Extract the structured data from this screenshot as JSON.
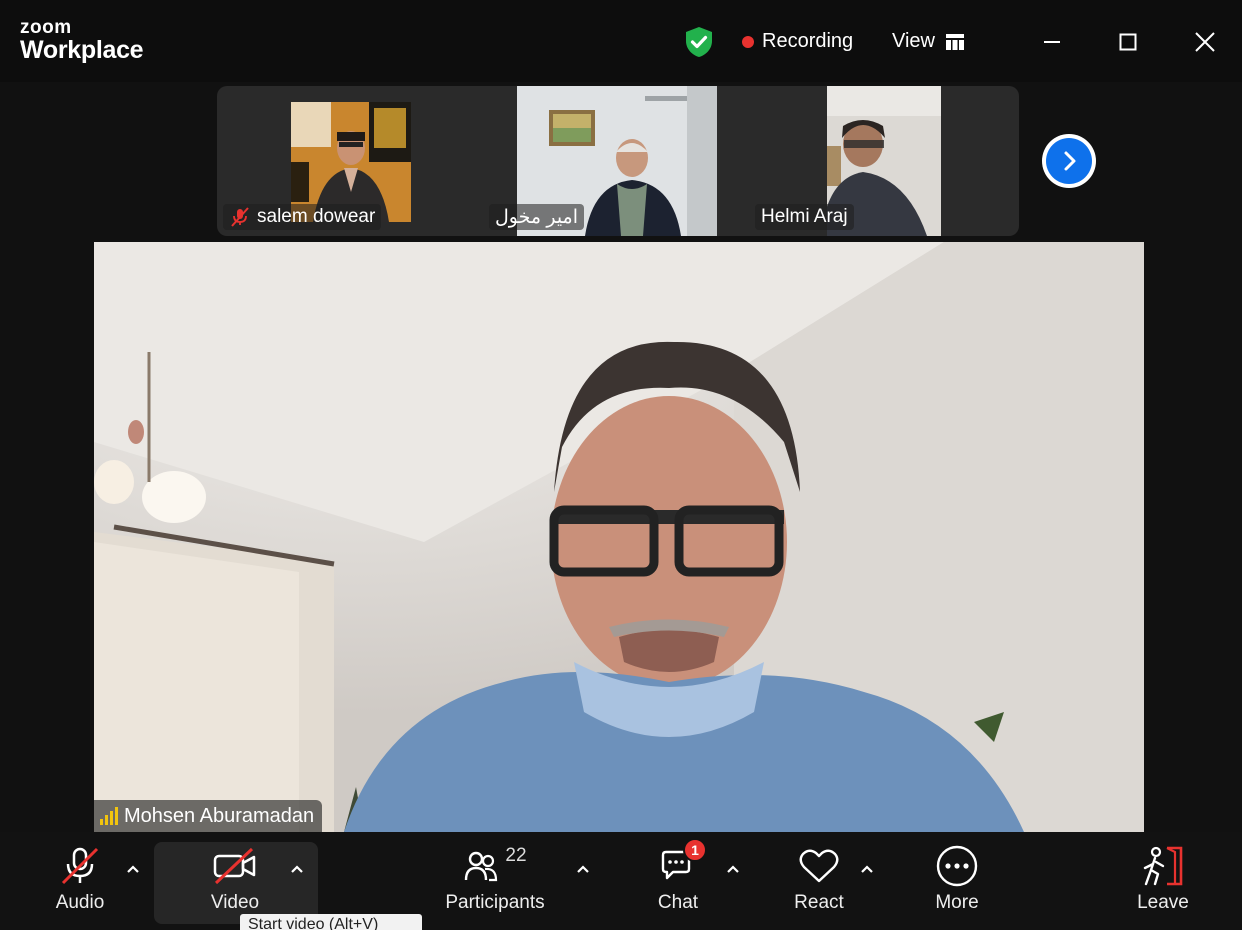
{
  "window": {
    "brand_top": "zoom",
    "brand_bottom": "Workplace",
    "recording_label": "Recording",
    "view_label": "View"
  },
  "participants_strip": [
    {
      "name": "salem dowear",
      "muted": true
    },
    {
      "name": "امير مخول",
      "muted": false
    },
    {
      "name": "Helmi Araj",
      "muted": false
    }
  ],
  "main_speaker": {
    "name": "Mohsen Aburamadan"
  },
  "toolbar": {
    "audio_label": "Audio",
    "video_label": "Video",
    "participants_label": "Participants",
    "participants_count": "22",
    "chat_label": "Chat",
    "chat_badge": "1",
    "react_label": "React",
    "more_label": "More",
    "leave_label": "Leave"
  },
  "tooltip": {
    "text": "Start video (Alt+V)"
  },
  "colors": {
    "accent_blue": "#0e71eb",
    "recording_red": "#e8322f",
    "shield_green": "#22b14c",
    "signal_yellow": "#f1c40f"
  }
}
